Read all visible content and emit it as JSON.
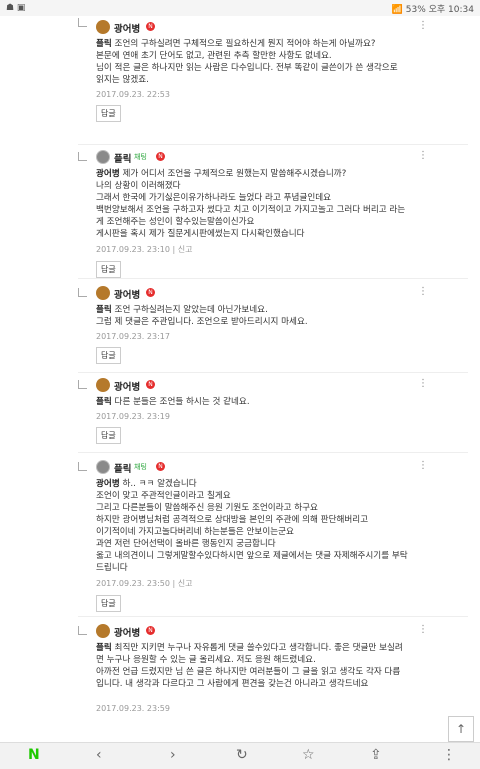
{
  "status_bar": {
    "left": "☗  ▣",
    "right": "📶 53% 오후 10:34"
  },
  "comments": [
    {
      "nick": "광어병",
      "mention": "플릭",
      "text": "  조언의 구하실려면 구체적으로 필요하신게 뭔지 적어야 하는게 아닐까요?\n본문에 연애 초기 단어도 없고, 관련된 추측 할만한 사항도 없네요.\n님이 적은 글은 하나지만 읽는 사람은 다수입니다. 전부 똑같이 글쓴이가 쓴 생각으로 읽지는 않겠죠.",
      "date": "2017.09.23. 22:53",
      "report": "",
      "btn": "답글"
    },
    {
      "nick": "플릭",
      "mention": "광어병",
      "text": "  제가 어디서 조언을 구체적으로 원했는지 말씀해주시겠습니까?\n나의 상황이 이러해졌다\n그래서 한국에 가기싫은이유가하나라도 늘었다 라고 푸념글인데요\n백번양보해서 조언을 구하고자 썼다고 치고 이기적이고 가지고놀고 그러다 버리고 라는게 조언해주는 성인이 할수있는말씀이신가요\n게시판을 혹시 제가 질문게시판에썼는지 다시확인했습니다",
      "date": "2017.09.23. 23:10",
      "report": "신고",
      "btn": "답글"
    },
    {
      "nick": "광어병",
      "mention": "플릭",
      "text": "  조언 구하실려는지 알았는데 아닌가보네요.\n그럼 제 댓글은 주관입니다. 조언으로 받아드리시지 마세요.",
      "date": "2017.09.23. 23:17",
      "report": "",
      "btn": "답글"
    },
    {
      "nick": "광어병",
      "mention": "플릭",
      "text": "  다른 분들은 조언들 하시는 것 같네요.",
      "date": "2017.09.23. 23:19",
      "report": "",
      "btn": "답글"
    },
    {
      "nick": "플릭",
      "mention": "광어병",
      "text": "  하.. ㅋㅋ 알겠습니다\n조언이 맞고 주관적인글이라고 칠게요\n그리고 다른분들이 말씀해주신 응원 기원도 조언이라고 하구요\n하지만 광어병님처럼 공격적으로 상대방을 본인의 주관에 의해 판단해버리고\n이기적이네 가지고놀다버리네 하는분들은 안보이는군요\n과연 저런 단어선택이 올바른 행동인지 궁금합니다\n옳고 내의견이니 그렇게말할수있다하시면 앞으로 제글에서는 댓글 자제해주시기를 부탁드립니다",
      "date": "2017.09.23. 23:50",
      "report": "신고",
      "btn": "답글"
    },
    {
      "nick": "광어병",
      "mention": "플릭",
      "text": "  최직만 지키면 누구나 자유롭게 댓글 쓸수있다고 생각합니다. 좋은 댓글만 보실려면 누구나 응원할 수 있는 글 올리세요. 저도 응원 해드렸네요.\n아까전 언급 드렸지만 님 쓴 글은 하나지만 여러분들이 그 글을 읽고 생각도 각자 다릅입니다. 내 생각과 다르다고 그 사람에게 편견을 갖는건 아니라고 생각드네요",
      "date": "2017.09.23. 23:59",
      "report": "",
      "btn": "답글"
    }
  ],
  "chat_label": "채팅",
  "n_badge": "N",
  "nav": {
    "home": "N",
    "back": "‹",
    "forward": "›",
    "refresh": "↻",
    "star": "☆",
    "share": "⇪",
    "more": "⋮",
    "top": "↑"
  }
}
